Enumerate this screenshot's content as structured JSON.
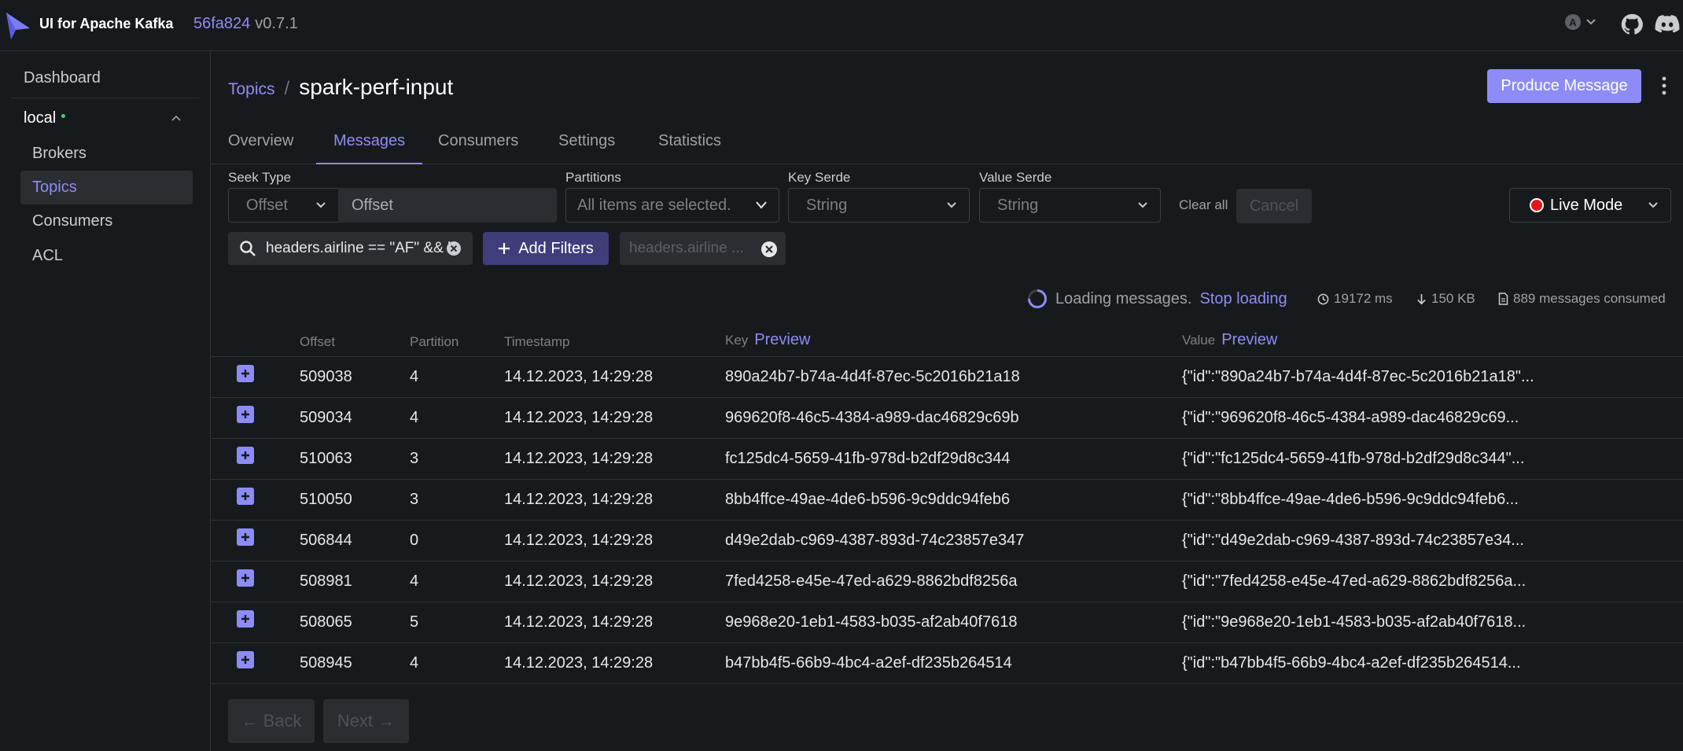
{
  "app": {
    "title": "UI for Apache Kafka",
    "commit": "56fa824",
    "version": "v0.7.1",
    "user_initial": "A"
  },
  "sidebar": {
    "dashboard": "Dashboard",
    "cluster": "local",
    "items": [
      {
        "label": "Brokers"
      },
      {
        "label": "Topics"
      },
      {
        "label": "Consumers"
      },
      {
        "label": "ACL"
      }
    ]
  },
  "breadcrumb": {
    "parent": "Topics",
    "separator": "/",
    "title": "spark-perf-input"
  },
  "produce_button": "Produce Message",
  "tabs": [
    "Overview",
    "Messages",
    "Consumers",
    "Settings",
    "Statistics"
  ],
  "filters": {
    "seek_type_label": "Seek Type",
    "seek_type_value": "Offset",
    "seek_offset_placeholder": "Offset",
    "partitions_label": "Partitions",
    "partitions_value": "All items are selected.",
    "key_serde_label": "Key Serde",
    "key_serde_value": "String",
    "value_serde_label": "Value Serde",
    "value_serde_value": "String",
    "clear_all": "Clear all",
    "cancel": "Cancel",
    "live_mode": "Live Mode",
    "search_value": "headers.airline == \"AF\" && headers.foo",
    "add_filters": "Add Filters",
    "active_filter": "headers.airline ..."
  },
  "status": {
    "loading": "Loading messages.",
    "stop": "Stop loading",
    "elapsed": "19172 ms",
    "bytes": "150 KB",
    "consumed": "889 messages consumed"
  },
  "table": {
    "headers": {
      "offset": "Offset",
      "partition": "Partition",
      "timestamp": "Timestamp",
      "key": "Key",
      "value": "Value",
      "preview": "Preview"
    },
    "rows": [
      {
        "offset": "509038",
        "partition": "4",
        "timestamp": "14.12.2023, 14:29:28",
        "key": "890a24b7-b74a-4d4f-87ec-5c2016b21a18",
        "value": "{\"id\":\"890a24b7-b74a-4d4f-87ec-5c2016b21a18\"..."
      },
      {
        "offset": "509034",
        "partition": "4",
        "timestamp": "14.12.2023, 14:29:28",
        "key": "969620f8-46c5-4384-a989-dac46829c69b",
        "value": "{\"id\":\"969620f8-46c5-4384-a989-dac46829c69..."
      },
      {
        "offset": "510063",
        "partition": "3",
        "timestamp": "14.12.2023, 14:29:28",
        "key": "fc125dc4-5659-41fb-978d-b2df29d8c344",
        "value": "{\"id\":\"fc125dc4-5659-41fb-978d-b2df29d8c344\"..."
      },
      {
        "offset": "510050",
        "partition": "3",
        "timestamp": "14.12.2023, 14:29:28",
        "key": "8bb4ffce-49ae-4de6-b596-9c9ddc94feb6",
        "value": "{\"id\":\"8bb4ffce-49ae-4de6-b596-9c9ddc94feb6..."
      },
      {
        "offset": "506844",
        "partition": "0",
        "timestamp": "14.12.2023, 14:29:28",
        "key": "d49e2dab-c969-4387-893d-74c23857e347",
        "value": "{\"id\":\"d49e2dab-c969-4387-893d-74c23857e34..."
      },
      {
        "offset": "508981",
        "partition": "4",
        "timestamp": "14.12.2023, 14:29:28",
        "key": "7fed4258-e45e-47ed-a629-8862bdf8256a",
        "value": "{\"id\":\"7fed4258-e45e-47ed-a629-8862bdf8256a..."
      },
      {
        "offset": "508065",
        "partition": "5",
        "timestamp": "14.12.2023, 14:29:28",
        "key": "9e968e20-1eb1-4583-b035-af2ab40f7618",
        "value": "{\"id\":\"9e968e20-1eb1-4583-b035-af2ab40f7618..."
      },
      {
        "offset": "508945",
        "partition": "4",
        "timestamp": "14.12.2023, 14:29:28",
        "key": "b47bb4f5-66b9-4bc4-a2ef-df235b264514",
        "value": "{\"id\":\"b47bb4f5-66b9-4bc4-a2ef-df235b264514..."
      }
    ]
  },
  "pagination": {
    "back": "← Back",
    "next": "Next →"
  },
  "colors": {
    "accent": "#8d8cf6",
    "background": "#171a1c",
    "live_dot": "#e5171b"
  }
}
